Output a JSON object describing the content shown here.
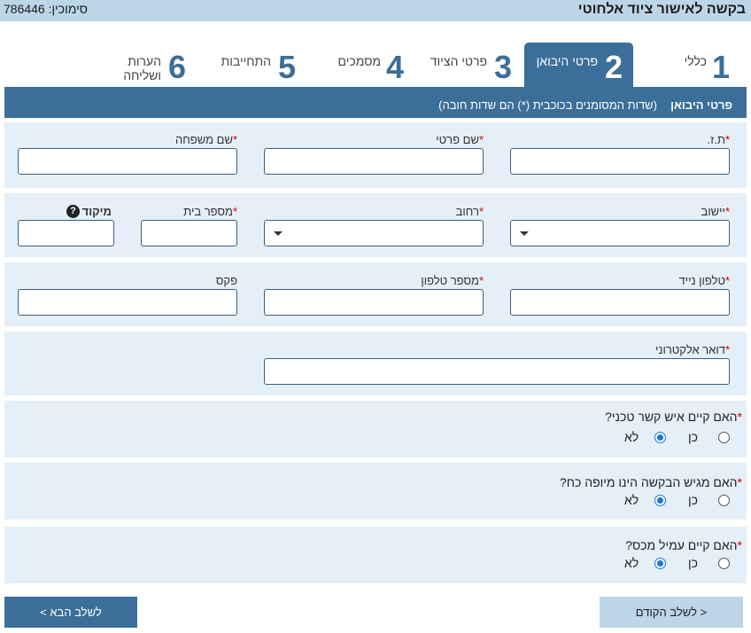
{
  "header": {
    "title": "בקשה לאישור ציוד אלחוטי",
    "reference": "סימוכין: 786446"
  },
  "tabs": [
    {
      "num": "1",
      "label": "כללי",
      "active": false
    },
    {
      "num": "2",
      "label": "פרטי היבואן",
      "active": true
    },
    {
      "num": "3",
      "label": "פרטי הציוד",
      "active": false
    },
    {
      "num": "4",
      "label": "מסמכים",
      "active": false
    },
    {
      "num": "5",
      "label": "התחייבות",
      "active": false
    },
    {
      "num": "6",
      "label_line1": "הערות",
      "label_line2": "ושליחה",
      "active": false
    }
  ],
  "section": {
    "title": "פרטי היבואן",
    "note": "(שדות המסומנים בכוכבית (*) הם שדות חובה)"
  },
  "fields": {
    "id_number": {
      "label": "ת.ז.",
      "value": ""
    },
    "first_name": {
      "label": "שם פרטי",
      "value": ""
    },
    "last_name": {
      "label": "שם משפחה",
      "value": ""
    },
    "city": {
      "label": "יישוב",
      "value": ""
    },
    "street": {
      "label": "רחוב",
      "value": ""
    },
    "house_number": {
      "label": "מספר בית",
      "value": ""
    },
    "zip": {
      "label": "מיקוד",
      "value": ""
    },
    "mobile": {
      "label": "טלפון נייד",
      "value": ""
    },
    "phone": {
      "label": "מספר טלפון",
      "value": ""
    },
    "fax": {
      "label": "פקס",
      "value": ""
    },
    "email": {
      "label": "דואר אלקטרוני",
      "value": ""
    }
  },
  "required_mark": "*",
  "help_icon": "?",
  "questions": [
    {
      "text": "האם קיים איש קשר טכני?",
      "yes": "כן",
      "no": "לא",
      "selected": "no"
    },
    {
      "text": "האם מגיש הבקשה הינו מיופה כח?",
      "yes": "כן",
      "no": "לא",
      "selected": "no"
    },
    {
      "text": "האם קיים עמיל מכס?",
      "yes": "כן",
      "no": "לא",
      "selected": "no"
    }
  ],
  "buttons": {
    "prev": "< לשלב הקודם",
    "next": "לשלב הבא >"
  },
  "colors": {
    "accent": "#3b6e98",
    "panel": "#e4eff8",
    "header": "#bcd6e8",
    "required": "#cc0000"
  }
}
